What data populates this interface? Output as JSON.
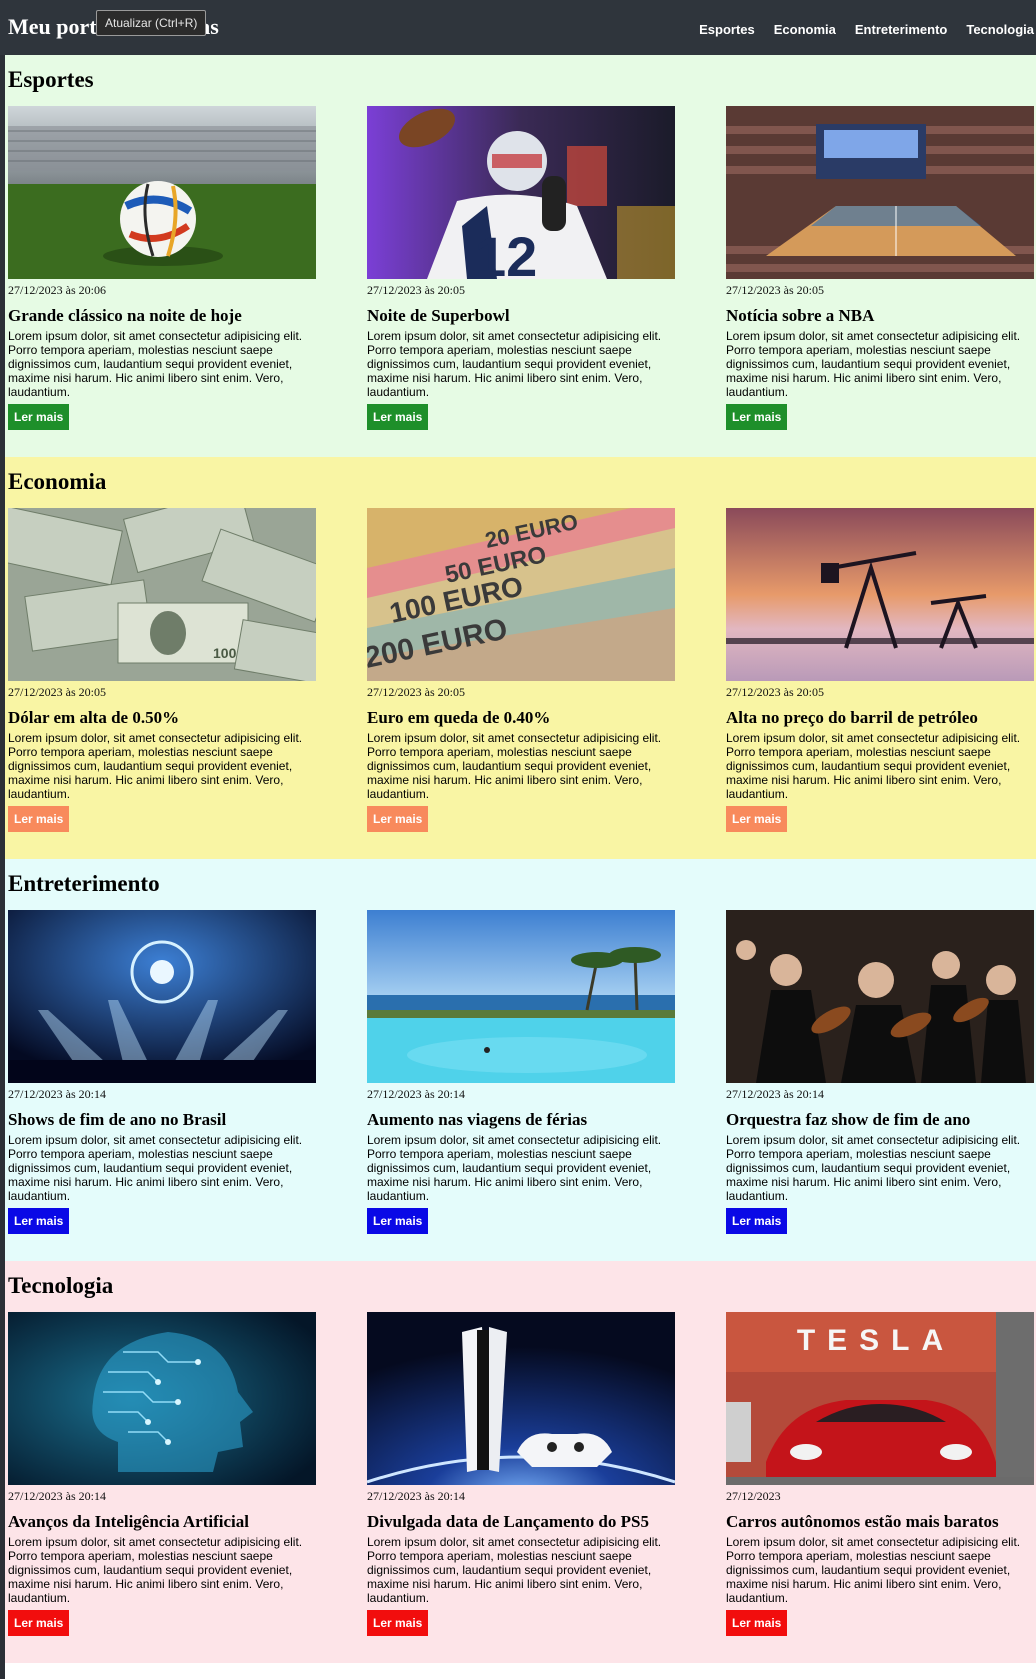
{
  "header": {
    "title": "Meu portal de notícias",
    "tooltip": "Atualizar (Ctrl+R)",
    "nav": [
      "Esportes",
      "Economia",
      "Entreterimento",
      "Tecnologia"
    ]
  },
  "colors": {
    "esportes_bg": "#e6fbe4",
    "economia_bg": "#f9f5a4",
    "entretenimento_bg": "#e4fcfb",
    "tecnologia_bg": "#fde4e8",
    "esportes_btn": "#1e8f2a",
    "economia_btn": "#f88a5c",
    "entretenimento_btn": "#0a09e6",
    "tecnologia_btn": "#f20d0d"
  },
  "button_label": "Ler mais",
  "lorem": "Lorem ipsum dolor, sit amet consectetur adipisicing elit. Porro tempora aperiam, molestias nesciunt saepe dignissimos cum, laudantium sequi provident eveniet, maxime nisi harum. Hic animi libero sint enim. Vero, laudantium.",
  "sections": [
    {
      "title": "Esportes",
      "cards": [
        {
          "date": "27/12/2023 às 20:06",
          "headline": "Grande clássico na noite de hoje",
          "image": "soccer-ball-on-pitch"
        },
        {
          "date": "27/12/2023 às 20:05",
          "headline": "Noite de Superbowl",
          "image": "football-quarterback"
        },
        {
          "date": "27/12/2023 às 20:05",
          "headline": "Notícia sobre a NBA",
          "image": "basketball-arena"
        }
      ]
    },
    {
      "title": "Economia",
      "cards": [
        {
          "date": "27/12/2023 às 20:05",
          "headline": "Dólar em alta de 0.50%",
          "image": "dollar-bills"
        },
        {
          "date": "27/12/2023 às 20:05",
          "headline": "Euro em queda de 0.40%",
          "image": "euro-notes"
        },
        {
          "date": "27/12/2023 às 20:05",
          "headline": "Alta no preço do barril de petróleo",
          "image": "oil-pumpjacks-sunset"
        }
      ]
    },
    {
      "title": "Entreterimento",
      "cards": [
        {
          "date": "27/12/2023 às 20:14",
          "headline": "Shows de fim de ano no Brasil",
          "image": "concert-stage-lights"
        },
        {
          "date": "27/12/2023 às 20:14",
          "headline": "Aumento nas viagens de férias",
          "image": "beach-resort-pool"
        },
        {
          "date": "27/12/2023 às 20:14",
          "headline": "Orquestra faz show de fim de ano",
          "image": "orchestra-violinists"
        }
      ]
    },
    {
      "title": "Tecnologia",
      "cards": [
        {
          "date": "27/12/2023 às 20:14",
          "headline": "Avanços da Inteligência Artificial",
          "image": "ai-circuit-head"
        },
        {
          "date": "27/12/2023 às 20:14",
          "headline": "Divulgada data de Lançamento do PS5",
          "image": "ps5-console"
        },
        {
          "date": "27/12/2023",
          "headline": "Carros autônomos estão mais baratos",
          "image": "tesla-red-car",
          "logo_text": "TESLA"
        }
      ]
    }
  ]
}
